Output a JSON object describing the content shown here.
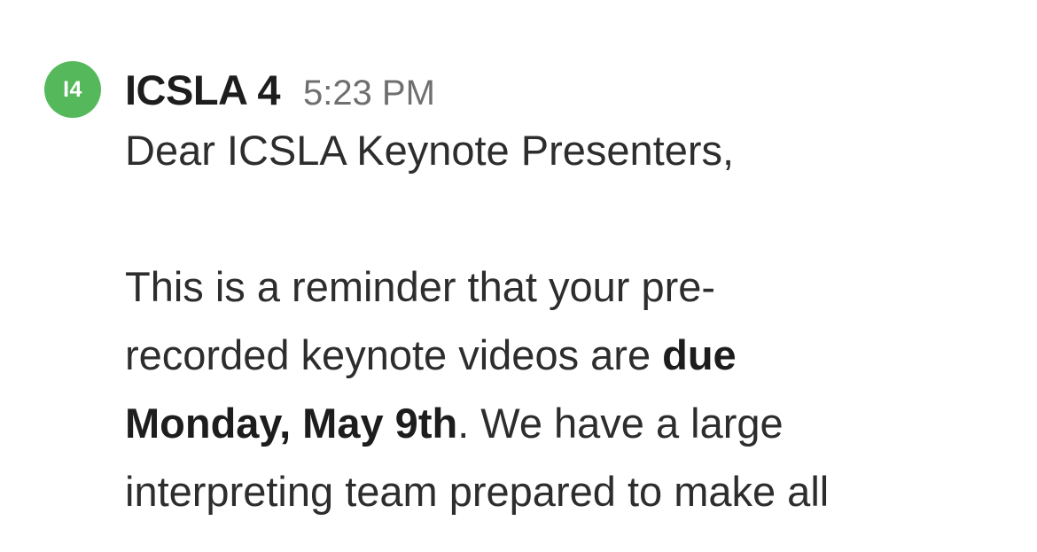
{
  "avatar": {
    "initials": "I4",
    "color": "#55b95c"
  },
  "message": {
    "sender": "ICSLA 4",
    "timestamp": "5:23 PM",
    "greeting": "Dear ICSLA Keynote Presenters,",
    "lines": {
      "line1": "This is a reminder that your pre-",
      "line2_normal": "recorded keynote videos are ",
      "line2_bold": "due",
      "line3_bold": "Monday, May 9th",
      "line3_normal": ". We have a large",
      "line4": "interpreting team prepared to make all"
    }
  }
}
